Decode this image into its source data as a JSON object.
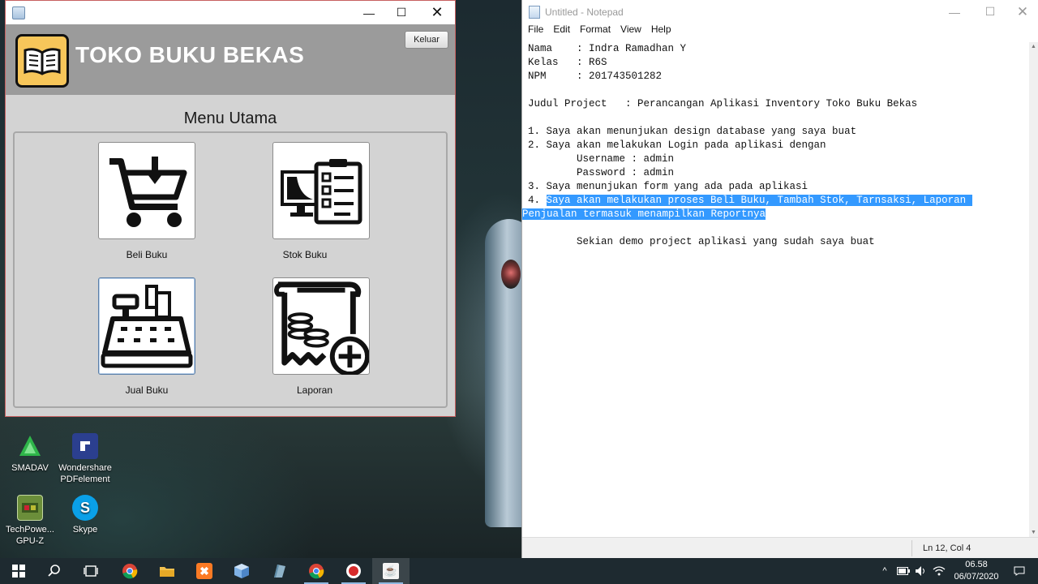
{
  "desktop": {
    "icons": [
      {
        "label": "SMADAV",
        "icon": "smadav-icon",
        "color": "#2fb54a"
      },
      {
        "label": "Wondershare PDFelement",
        "icon": "pdfelement-icon",
        "color": "#2b3f8f"
      },
      {
        "label": "TechPowe... GPU-Z",
        "icon": "gpuz-icon",
        "color": "#6b8e3a"
      },
      {
        "label": "Skype",
        "icon": "skype-icon",
        "color": "#0aa0e8"
      }
    ]
  },
  "app": {
    "title": "TOKO BUKU BEKAS",
    "exit_label": "Keluar",
    "menu_title": "Menu Utama",
    "menu": [
      {
        "label": "Beli Buku",
        "icon": "shopping-cart-icon"
      },
      {
        "label": "Stok Buku",
        "icon": "inventory-clipboard-icon"
      },
      {
        "label": "Jual Buku",
        "icon": "cash-register-icon"
      },
      {
        "label": "Laporan",
        "icon": "report-add-icon"
      }
    ]
  },
  "notepad": {
    "title": "Untitled - Notepad",
    "menus": [
      "File",
      "Edit",
      "Format",
      "View",
      "Help"
    ],
    "lines": [
      "Nama    : Indra Ramadhan Y",
      "Kelas   : R6S",
      "NPM     : 201743501282",
      "",
      "Judul Project   : Perancangan Aplikasi Inventory Toko Buku Bekas",
      "",
      "1. Saya akan menunjukan design database yang saya buat",
      "2. Saya akan melakukan Login pada aplikasi dengan",
      "        Username : admin",
      "        Password : admin",
      "3. Saya menunjukan form yang ada pada aplikasi",
      "",
      "",
      "",
      "        Sekian demo project aplikasi yang sudah saya buat"
    ],
    "selected_line_prefix": "4. ",
    "selected_line_1": "Saya akan melakukan proses Beli Buku, Tambah Stok, Tarnsaksi, Laporan ",
    "selected_line_2": "Penjualan termasuk menampilkan Reportnya",
    "status_position": "Ln 12, Col 4",
    "selection_color": "#3399ff"
  },
  "taskbar": {
    "time": "06.58",
    "date": "06/07/2020"
  }
}
